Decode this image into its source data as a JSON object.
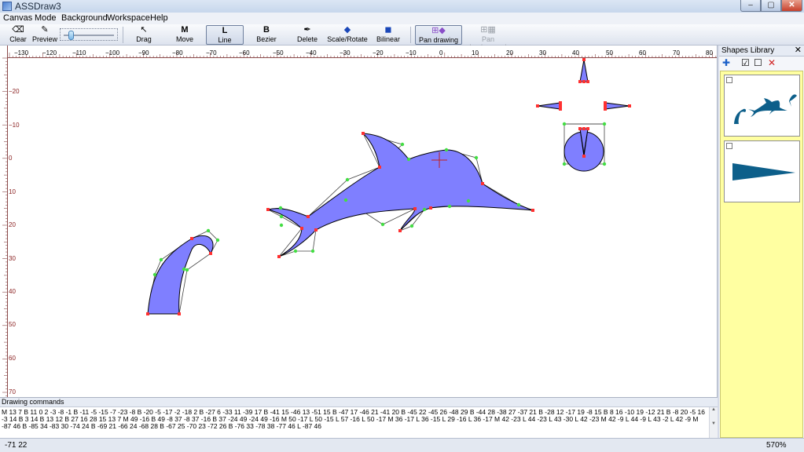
{
  "window": {
    "title": "ASSDraw3",
    "min_glyph": "–",
    "max_glyph": "▢",
    "close_glyph": "✕"
  },
  "menu": [
    "Canvas",
    "Mode",
    "Background",
    "Workspace",
    "Help"
  ],
  "toolbar": {
    "clear": "Clear",
    "preview": "Preview",
    "drag": "Drag",
    "move": "Move",
    "line": "Line",
    "bezier": "Bezier",
    "delete": "Delete",
    "scale_rotate": "Scale/Rotate",
    "bilinear": "Bilinear",
    "pan_drawing": "Pan drawing",
    "pan_background": "Pan background",
    "move_glyph": "M",
    "line_glyph": "L",
    "bezier_glyph": "B",
    "active_tool": "Line"
  },
  "ruler": {
    "x_ticks": [
      "−130",
      "−120",
      "−110",
      "−100",
      "−90",
      "−80",
      "−70",
      "−60",
      "−50",
      "−40",
      "−30",
      "−20",
      "−10",
      "0",
      "10",
      "20",
      "30",
      "40",
      "50",
      "60",
      "70",
      "80"
    ],
    "y_ticks": [
      "−20",
      "−10",
      "0",
      "10",
      "20",
      "30",
      "40",
      "50",
      "60",
      "70"
    ]
  },
  "library": {
    "title": "Shapes Library",
    "close": "✕",
    "tools": {
      "add": "✚",
      "check": "☑",
      "uncheck": "☐",
      "delete": "✕"
    }
  },
  "commands": {
    "title": "Drawing commands",
    "text": "M 13 7 B 11 0 2 -3 -8 -1 B -11 -5 -15 -7 -23 -8 B -20 -5 -17 -2 -18 2 B -27 6 -33 11 -39 17 B -41 15 -46 13 -51 15 B -47 17 -46 21 -41 20 B -45 22 -45 26 -48 29 B -44 28 -38 27 -37 21 B -28 12 -17 19 -8 15 B 8 16 -10 19 -12 21 B -8 20 -5 16 -3 14 B 3 14 B 13 12 B 27 16 28 15 13 7 M 49 -16 B 49 -8 37 -8 37 -16 B 37 -24 49 -24 49 -16 M 50 -17 L 50 -15 L 57 -16 L 50 -17 M 36 -17 L 36 -15 L 29 -16 L 36 -17 M 42 -23 L 44 -23 L 43 -30 L 42 -23 M 42 -9 L 44 -9 L 43 -2 L 42 -9 M -87 46 B -85 34 -83 30 -74 24 B -69 21 -66 24 -68 28 B -67 25 -70 23 -72 26 B -76 33 -78 38 -77 46 L -87 46"
  },
  "status": {
    "coords": "-71  22",
    "zoom": "570%"
  },
  "colors": {
    "fill": "#7f7fff",
    "point_red": "#ff3030",
    "point_green": "#44dd44",
    "library_bg": "#ffffa1",
    "library_shape": "#0d5f8a"
  }
}
